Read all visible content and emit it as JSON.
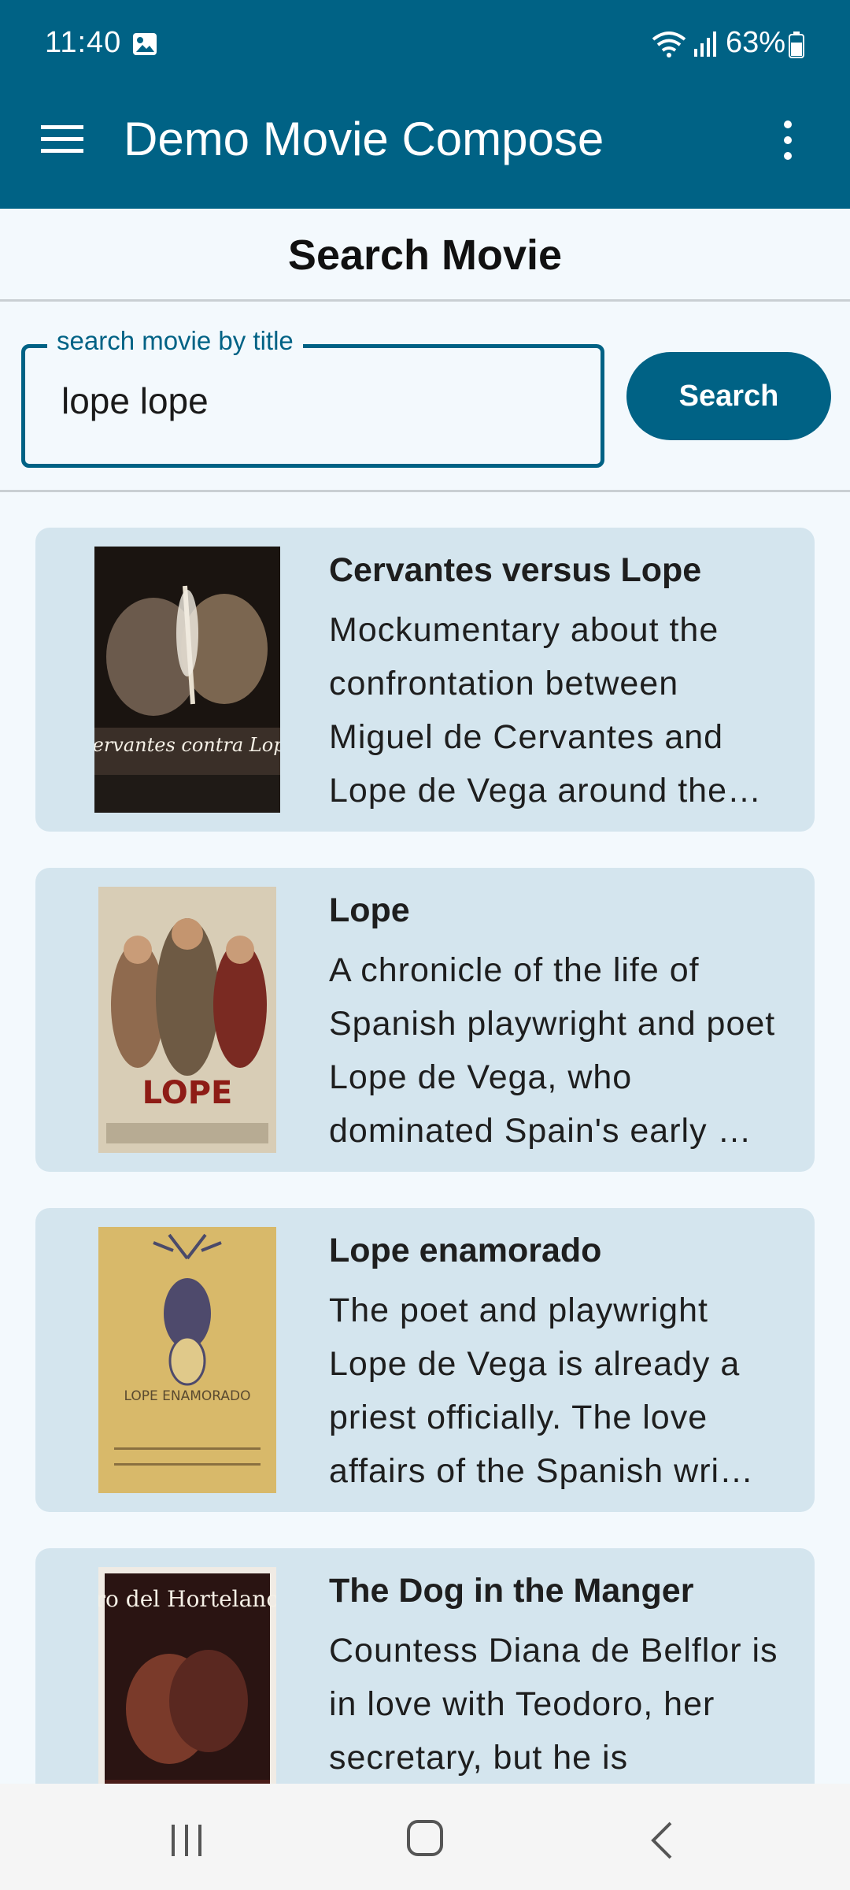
{
  "status_bar": {
    "time": "11:40",
    "battery": "63%",
    "icons": [
      "image-icon",
      "wifi-icon",
      "signal-icon",
      "battery-icon"
    ]
  },
  "app_bar": {
    "title": "Demo Movie Compose",
    "icons": [
      "menu-icon",
      "more-vert-icon"
    ]
  },
  "page": {
    "heading": "Search Movie"
  },
  "search": {
    "label": "search movie by title",
    "value": "lope lope",
    "button_label": "Search"
  },
  "results": [
    {
      "title": "Cervantes versus Lope",
      "overview": "Mockumentary about the confrontation between Miguel de Cervantes and Lope de Vega around the…",
      "poster_text": "Cervantes contra Lope"
    },
    {
      "title": "Lope",
      "overview": "A chronicle of the life of Spanish playwright and poet Lope de Vega, who dominated Spain's early …",
      "poster_text": "LOPE"
    },
    {
      "title": "Lope enamorado",
      "overview": "The poet and playwright Lope de Vega is already a priest officially. The love affairs of the Spanish wri…",
      "poster_text": "LOPE ENAMORADO"
    },
    {
      "title": "The Dog in the Manger",
      "overview": "Countess Diana de Belflor is in love with Teodoro, her secretary, but he is",
      "poster_text": "El Perro del Hortelano"
    }
  ],
  "colors": {
    "primary": "#006285",
    "card_bg": "#d4e5ee",
    "page_bg": "#f3f9fd"
  }
}
